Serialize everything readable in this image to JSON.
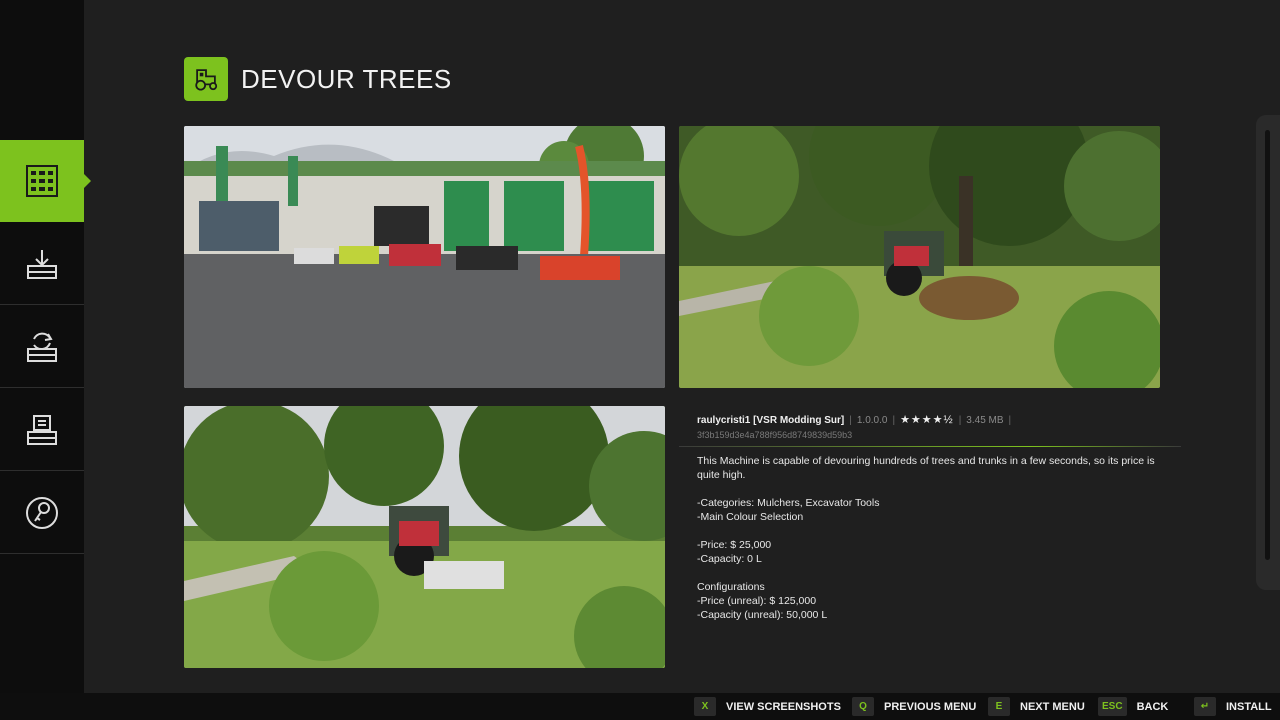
{
  "header": {
    "title": "DEVOUR TREES",
    "icon": "tractor-icon"
  },
  "sidebar": {
    "items": [
      {
        "icon": "grid-icon",
        "active": true
      },
      {
        "icon": "download-icon",
        "active": false
      },
      {
        "icon": "update-icon",
        "active": false
      },
      {
        "icon": "installed-icon",
        "active": false
      },
      {
        "icon": "key-icon",
        "active": false
      }
    ]
  },
  "mod": {
    "author": "raulycristi1 [VSR Modding Sur]",
    "version": "1.0.0.0",
    "rating": "★★★★½",
    "size": "3.45 MB",
    "hash": "3f3b159d3e4a788f956d8749839d59b3",
    "description_lines": [
      "This Machine is capable of devouring hundreds of trees and trunks in a few seconds, so its price is quite high.",
      "",
      "-Categories: Mulchers, Excavator Tools",
      "-Main Colour Selection",
      "",
      "-Price: $ 25,000",
      "-Capacity: 0 L",
      "",
      "Configurations",
      "-Price (unreal): $ 125,000",
      "-Capacity (unreal): 50,000 L"
    ]
  },
  "bottombar": {
    "view_key": "X",
    "view_label": "VIEW SCREENSHOTS",
    "prev_key": "Q",
    "prev_label": "PREVIOUS MENU",
    "next_key": "E",
    "next_label": "NEXT MENU",
    "back_key": "ESC",
    "back_label": "BACK",
    "install_key": "↵",
    "install_label": "INSTALL"
  },
  "colors": {
    "accent": "#7dc21e",
    "background": "#1f1f1f",
    "sidebar": "#0d0d0d"
  }
}
